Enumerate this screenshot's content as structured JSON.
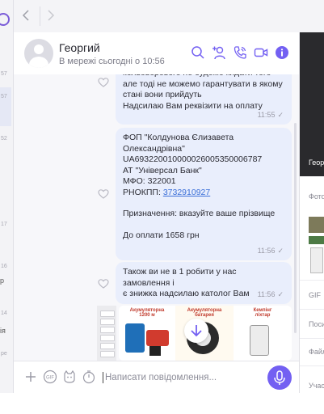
{
  "chat_list": {
    "times": [
      "57",
      "52",
      "17",
      "16",
      "14"
    ],
    "words": [
      "р",
      "ія"
    ],
    "extra_times": [
      "ре"
    ]
  },
  "nav": {
    "back_icon": "chevron-left-icon",
    "forward_icon": "chevron-right-icon"
  },
  "header": {
    "name": "Георгий",
    "status": "В мережі сьогодні о 10:56",
    "icons": [
      "search-icon",
      "add-person-icon",
      "call-icon",
      "video-call-icon",
      "info-icon"
    ]
  },
  "messages": [
    {
      "text": "кольоворового не будемо кидати того\nале тоді не можемо гарантувати в якому\nстані вони прийдуть\nНадсилаю Вам реквізити на оплату",
      "time": "11:55"
    },
    {
      "line1": "ФОП \"Колдунова Єлизавета\nОлександрівна\"\nUA693220010000026005350006787\nАТ \"Універсал Банк\"\nМФО: 322001",
      "rnokpp_label": "РНОКПП: ",
      "rnokpp_value": "3732910927",
      "line2": "Призначення: вказуйте ваше прізвище\n\nДо оплати 1658 грн",
      "time": "11:56"
    },
    {
      "text": "Також ви не в 1 робити у нас замовлення і\nє знижка надсилаю католог Вам",
      "time": "11:56"
    }
  ],
  "catalog_titles": [
    "Акумуляторна\n1200 м",
    "Акумуляторна\nбатарея",
    "Кемпінг\nліхтар"
  ],
  "composer": {
    "placeholder": "Написати повідомлення...",
    "icons": [
      "plus-icon",
      "gif-icon",
      "sticker-icon",
      "timer-icon",
      "microphone-icon"
    ]
  },
  "right_panel": {
    "photo_label": "Георг",
    "sections": [
      "Фото",
      "GIF",
      "Поси",
      "Файл",
      "Учас"
    ]
  },
  "colors": {
    "accent": "#7360f2",
    "bubble": "#e9eefc",
    "link": "#3b6fd8"
  }
}
